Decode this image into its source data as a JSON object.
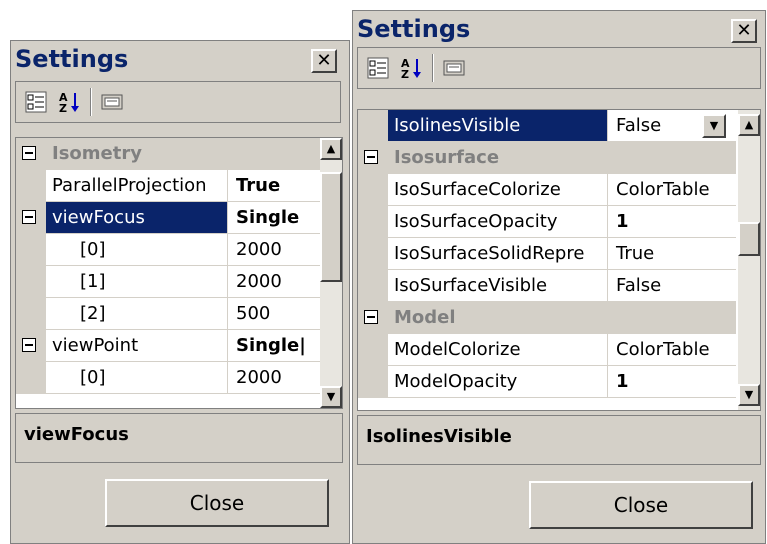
{
  "left_window": {
    "title": "Settings",
    "close_glyph": "✕",
    "rows": [
      {
        "type": "category",
        "name": "Isometry"
      },
      {
        "type": "prop",
        "name": "ParallelProjection",
        "value": "True",
        "bold": true
      },
      {
        "type": "parent",
        "name": "viewFocus",
        "value": "Single",
        "bold": true,
        "selected": true
      },
      {
        "type": "prop",
        "indent": 1,
        "name": "[0]",
        "value": "2000"
      },
      {
        "type": "prop",
        "indent": 1,
        "name": "[1]",
        "value": "2000"
      },
      {
        "type": "prop",
        "indent": 1,
        "name": "[2]",
        "value": "500"
      },
      {
        "type": "parent",
        "name": "viewPoint",
        "value": "Single|",
        "bold": true
      },
      {
        "type": "prop",
        "indent": 1,
        "name": "[0]",
        "value": "2000"
      }
    ],
    "description": "viewFocus",
    "button": "Close"
  },
  "right_window": {
    "title": "Settings",
    "close_glyph": "✕",
    "rows": [
      {
        "type": "prop",
        "name": "IsolinesVisible",
        "value": "False",
        "selected": true,
        "dropdown": true
      },
      {
        "type": "category",
        "name": "Isosurface"
      },
      {
        "type": "prop",
        "name": "IsoSurfaceColorize",
        "value": "ColorTable"
      },
      {
        "type": "prop",
        "name": "IsoSurfaceOpacity",
        "value": "1",
        "bold": true
      },
      {
        "type": "prop",
        "name": "IsoSurfaceSolidRepre",
        "value": "True"
      },
      {
        "type": "prop",
        "name": "IsoSurfaceVisible",
        "value": "False"
      },
      {
        "type": "category",
        "name": "Model"
      },
      {
        "type": "prop",
        "name": "ModelColorize",
        "value": "ColorTable"
      },
      {
        "type": "prop",
        "name": "ModelOpacity",
        "value": "1",
        "bold": true
      }
    ],
    "description": "IsolinesVisible",
    "button": "Close"
  },
  "toolbar_icons": [
    "categorized-icon",
    "alphabetical-sort-icon",
    "property-pages-icon"
  ],
  "colors": {
    "selection": "#0a246a",
    "face": "#d4d0c8",
    "category_text": "#808080"
  }
}
